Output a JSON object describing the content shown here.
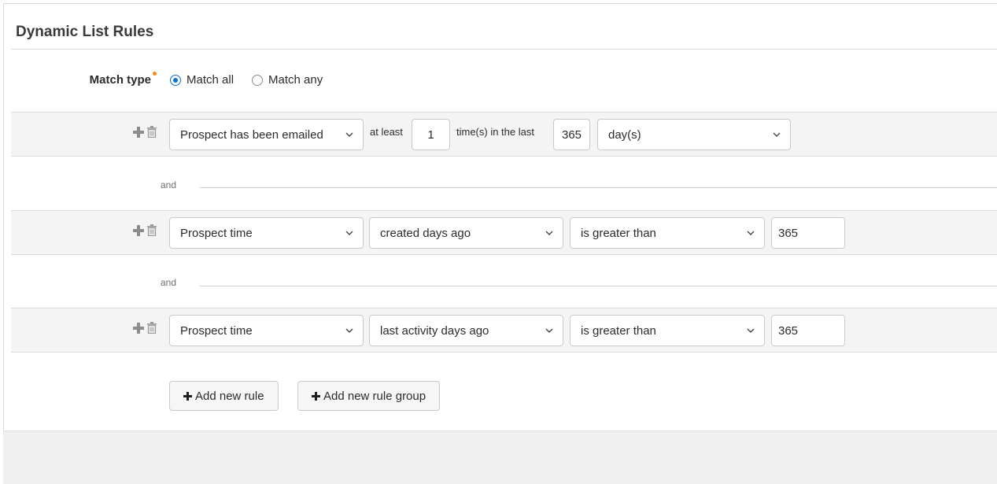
{
  "panel": {
    "title": "Dynamic List Rules"
  },
  "match_type": {
    "label": "Match type",
    "options": [
      {
        "label": "Match all",
        "checked": true
      },
      {
        "label": "Match any",
        "checked": false
      }
    ]
  },
  "rules": [
    {
      "field": "Prospect has been emailed",
      "at_least_label": "at least",
      "count": "1",
      "times_label": "time(s) in the last",
      "period_value": "365",
      "period_unit": "day(s)"
    },
    {
      "field": "Prospect time",
      "attribute": "created days ago",
      "operator": "is greater than",
      "value": "365"
    },
    {
      "field": "Prospect time",
      "attribute": "last activity days ago",
      "operator": "is greater than",
      "value": "365"
    }
  ],
  "connector_label": "and",
  "buttons": {
    "add_rule": "Add new rule",
    "add_rule_group": "Add new rule group"
  },
  "icons": [
    "plus-icon",
    "trash-icon",
    "chevron-down-icon",
    "radio-icon"
  ],
  "colors": {
    "accent": "#0b6fd6",
    "required": "#f28b1e",
    "row_bg": "#f4f4f4"
  }
}
